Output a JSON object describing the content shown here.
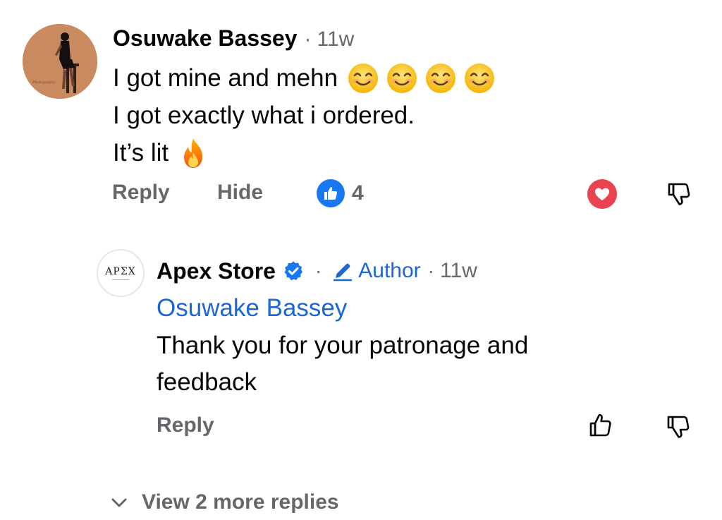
{
  "comment": {
    "author": "Osuwake Bassey",
    "separator": "·",
    "time": "11w",
    "lines": [
      "I got mine and mehn",
      "I got exactly what i ordered.",
      "It’s lit"
    ],
    "emojis_line1": [
      "smiling-face-emoji",
      "smiling-face-emoji",
      "smiling-face-emoji",
      "smiling-face-emoji"
    ],
    "emoji_line3": "fire-emoji",
    "actions": {
      "reply_label": "Reply",
      "hide_label": "Hide",
      "like_count": "4"
    }
  },
  "reply": {
    "author": "Apex Store",
    "avatar_text": "APΣX",
    "separator": "·",
    "badge_label": "Author",
    "separator2": "·",
    "time": "11w",
    "mention": "Osuwake Bassey",
    "body": "Thank you for your patronage and feedback",
    "actions": {
      "reply_label": "Reply"
    }
  },
  "view_more": {
    "label": "View 2 more replies"
  },
  "colors": {
    "text_primary": "#050505",
    "text_secondary": "#65676b",
    "link_blue": "#1b67d3",
    "like_blue": "#1877f2",
    "heart_red": "#e8434f"
  }
}
